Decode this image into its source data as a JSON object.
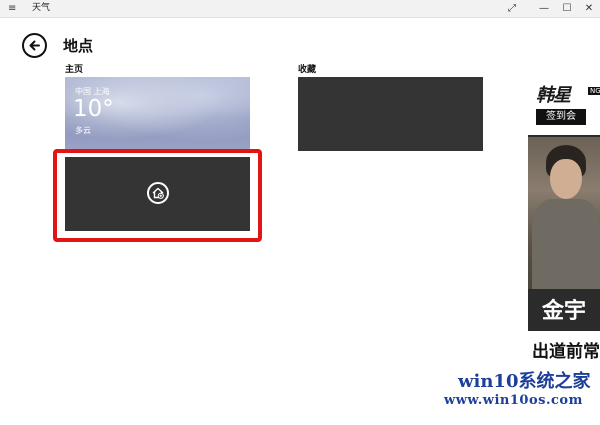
{
  "window": {
    "title": "天气",
    "menu_icon": "hamburger-icon",
    "controls": [
      "expand-icon",
      "minimize-icon",
      "maximize-icon",
      "close-icon"
    ]
  },
  "header": {
    "back_icon": "back-arrow-icon",
    "title": "地点"
  },
  "sections": {
    "home": "主页",
    "favorites": "收藏"
  },
  "home_tile": {
    "city": "中国 上海",
    "temperature": "10°",
    "condition": "多云"
  },
  "add_tile": {
    "icon": "add-home-icon"
  },
  "colors": {
    "highlight": "#e21414",
    "tile_dark": "#343434",
    "watermark": "#1d3e99"
  },
  "ad": {
    "logo": "韩星",
    "badge": "NG",
    "tagline": "签到会",
    "big_text": "金宇",
    "bottom_text": "出道前常"
  },
  "watermark": {
    "line1": "win10系统之家",
    "line2": "www.win10os.com"
  }
}
